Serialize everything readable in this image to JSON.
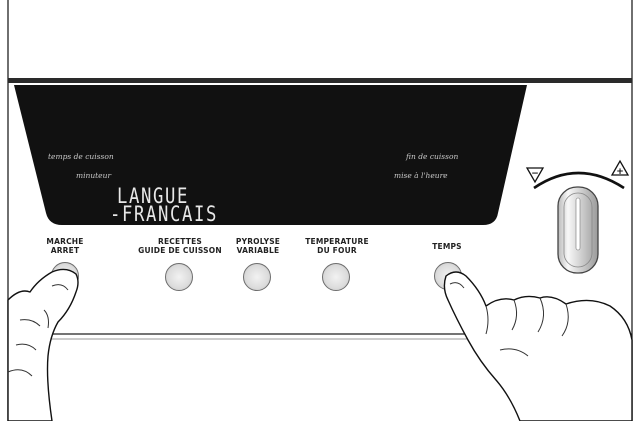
{
  "display": {
    "left_top": "temps de cuisson",
    "left_bottom": "minuteur",
    "right_top": "fin de cuisson",
    "right_bottom": "mise à l'heure",
    "line1": "LANGUE",
    "line2": "-FRANCAIS"
  },
  "buttons": {
    "marche": {
      "line1": "Marche",
      "line2": "Arret"
    },
    "recettes": {
      "line1": "Recettes",
      "line2": "Guide de Cuisson"
    },
    "pyrolyse": {
      "line1": "Pyrolyse",
      "line2": "Variable"
    },
    "temperature": {
      "line1": "Temperature",
      "line2": "du Four"
    },
    "temps": {
      "line1": "Temps",
      "line2": ""
    }
  },
  "dial": {
    "minus_symbol": "−",
    "plus_symbol": "+"
  },
  "icons": {
    "minus": "minus-icon",
    "plus": "plus-icon",
    "knob": "rotary-knob-icon",
    "hand_left": "pointing-hand-icon",
    "hand_right": "pointing-hand-icon"
  }
}
